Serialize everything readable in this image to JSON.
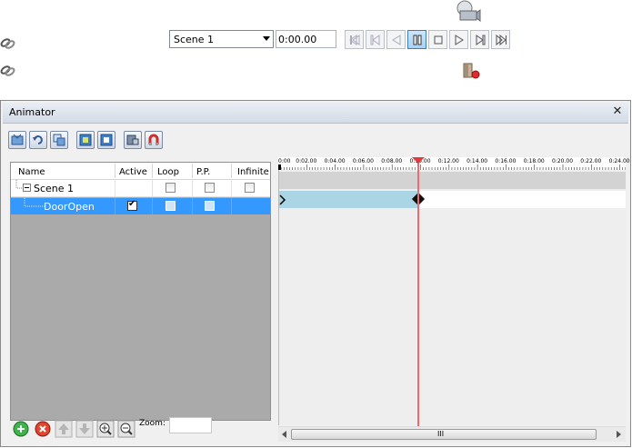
{
  "panel": {
    "title": "Animator",
    "close_label": "✕"
  },
  "toolbar": {
    "scene_select_value": "Scene 1",
    "time_value": "0:00.00"
  },
  "table": {
    "columns": [
      "Name",
      "Active",
      "Loop",
      "P.P.",
      "Infinite"
    ],
    "rows": [
      {
        "name": "Scene 1",
        "active": null,
        "loop": false,
        "pp": false,
        "infinite": false
      },
      {
        "name": "DoorOpen",
        "active": true,
        "loop": false,
        "pp": false,
        "infinite": null
      }
    ]
  },
  "bottom": {
    "zoom_label": "Zoom:",
    "zoom_value": ""
  },
  "timeline": {
    "ruler_labels": [
      "0:00",
      "0:02.00",
      "0:04.00",
      "0:06.00",
      "0:08.00",
      "0:10.00",
      "0:12.00",
      "0:14.00",
      "0:16.00",
      "0:18.00",
      "0:20.00",
      "0:22.00",
      "0:24.00"
    ],
    "playhead_time": "0:10.00",
    "clip_name": "DoorOpen",
    "clip_end_time": "0:10.00",
    "scroll_grip": "III"
  },
  "colors": {
    "selection": "#3399ff",
    "clip": "#a9d5e5",
    "playhead": "#ef6b6b"
  }
}
